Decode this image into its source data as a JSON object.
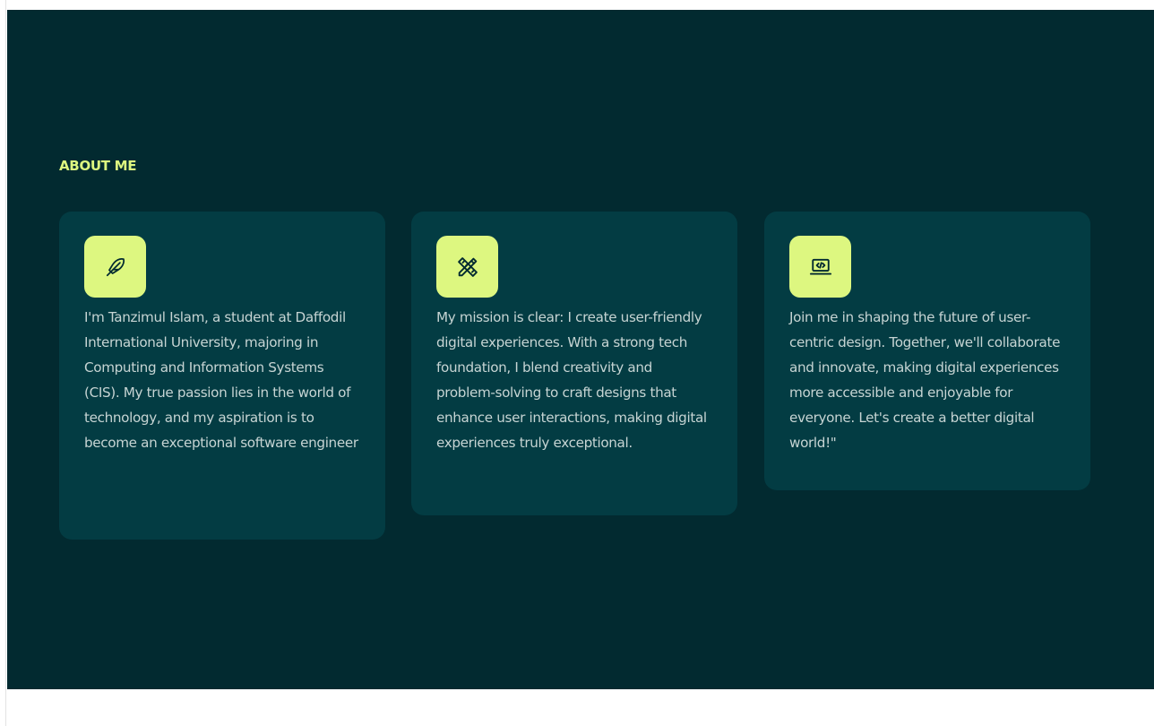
{
  "about": {
    "title": "ABOUT ME",
    "accent_color": "#ddf780",
    "background_color": "#022a30",
    "card_color": "#033c43",
    "cards": [
      {
        "icon": "feather-icon",
        "text": "I'm Tanzimul Islam, a student at Daffodil International University, majoring in Computing and Information Systems (CIS). My true passion lies in the world of technology, and my aspiration is to become an exceptional software engineer"
      },
      {
        "icon": "pencil-ruler-icon",
        "text": "My mission is clear: I create user-friendly digital experiences. With a strong tech foundation, I blend creativity and problem-solving to craft designs that enhance user interactions, making digital experiences truly exceptional."
      },
      {
        "icon": "laptop-code-icon",
        "text": "Join me in shaping the future of user-centric design. Together, we'll collaborate and innovate, making digital experiences more accessible and enjoyable for everyone. Let's create a better digital world!\""
      }
    ]
  }
}
